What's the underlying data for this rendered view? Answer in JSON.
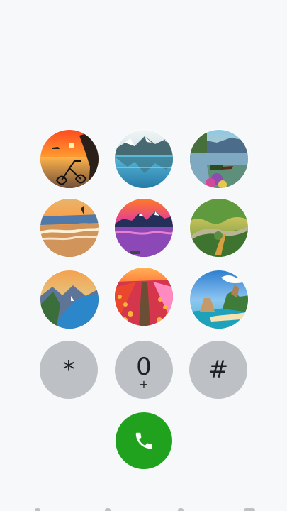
{
  "dialpad": {
    "star": "*",
    "zero_main": "0",
    "zero_sub": "+",
    "hash": "#"
  },
  "icons": {
    "call": "phone-icon"
  },
  "colors": {
    "background": "#f7f8fa",
    "key_gray": "#bdc1c6",
    "call_green": "#21a21f"
  }
}
